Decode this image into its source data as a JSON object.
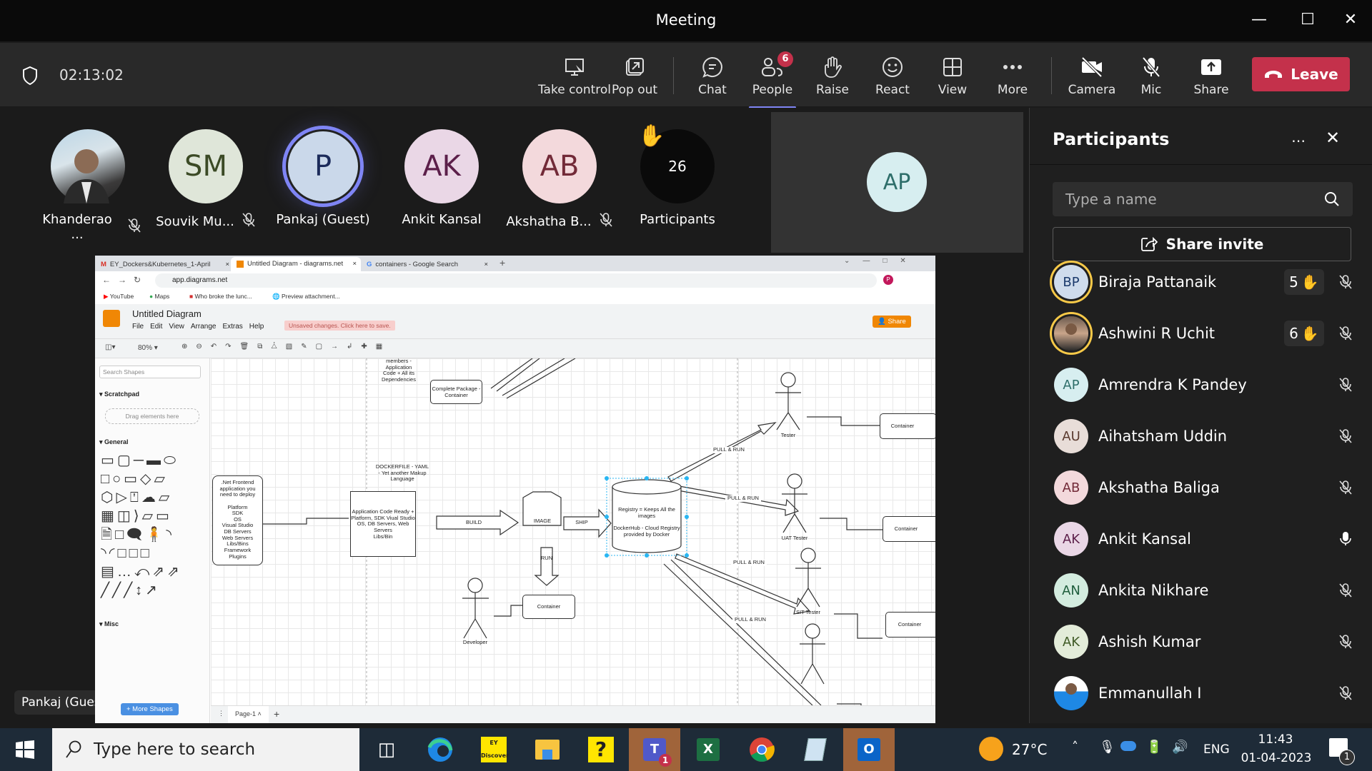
{
  "window": {
    "title": "Meeting"
  },
  "toolbar": {
    "timer": "02:13:02",
    "buttons": [
      {
        "label": "Take control",
        "icon": "take-control-icon"
      },
      {
        "label": "Pop out",
        "icon": "pop-out-icon"
      },
      {
        "label": "Chat",
        "icon": "chat-icon"
      },
      {
        "label": "People",
        "icon": "people-icon",
        "badge": "6"
      },
      {
        "label": "Raise",
        "icon": "raise-hand-icon"
      },
      {
        "label": "React",
        "icon": "react-icon"
      },
      {
        "label": "View",
        "icon": "view-icon"
      },
      {
        "label": "More",
        "icon": "more-icon"
      },
      {
        "label": "Camera",
        "icon": "camera-off-icon"
      },
      {
        "label": "Mic",
        "icon": "mic-off-icon"
      },
      {
        "label": "Share",
        "icon": "share-icon"
      }
    ],
    "leave_label": "Leave"
  },
  "stage": {
    "tiles": [
      {
        "name": "Khanderao ...",
        "initials": "",
        "photo": true,
        "muted": true
      },
      {
        "name": "Souvik Mu...",
        "initials": "SM",
        "bg": "#dfe6d9",
        "fg": "#3b4a25",
        "muted": true
      },
      {
        "name": "Pankaj (Guest)",
        "initials": "P",
        "bg": "#cad8ea",
        "fg": "#1b2a5a",
        "muted": false,
        "speaking": true
      },
      {
        "name": "Ankit Kansal",
        "initials": "AK",
        "bg": "#ead7e6",
        "fg": "#5c1f4a",
        "muted": false
      },
      {
        "name": "Akshatha B...",
        "initials": "AB",
        "bg": "#f3d9dc",
        "fg": "#722a38",
        "muted": true
      }
    ],
    "overflow": {
      "count": "26",
      "label": "Participants"
    },
    "spotlight": {
      "initials": "AP",
      "bg": "#d7eef0",
      "fg": "#2e6e6a"
    },
    "presenter_label": "Pankaj (Guest)"
  },
  "panel": {
    "title": "Participants",
    "search_placeholder": "Type a name",
    "share_invite": "Share invite",
    "participants": [
      {
        "name": "Biraja Pattanaik",
        "initials": "BP",
        "bg": "#cfdcec",
        "fg": "#1b3a6b",
        "hand": "5",
        "mic": "off",
        "ring": true
      },
      {
        "name": "Ashwini R Uchit",
        "initials": "",
        "photo": true,
        "hand": "6",
        "mic": "off",
        "ring": true
      },
      {
        "name": "Amrendra K Pandey",
        "initials": "AP",
        "bg": "#d7eef0",
        "fg": "#2e6e6a",
        "mic": "off"
      },
      {
        "name": "Aihatsham Uddin",
        "initials": "AU",
        "bg": "#e8ddd8",
        "fg": "#5a3a2e",
        "mic": "off"
      },
      {
        "name": "Akshatha Baliga",
        "initials": "AB",
        "bg": "#f3d9dc",
        "fg": "#722a38",
        "mic": "off"
      },
      {
        "name": "Ankit Kansal",
        "initials": "AK",
        "bg": "#ead7e6",
        "fg": "#5c1f4a",
        "mic": "on"
      },
      {
        "name": "Ankita Nikhare",
        "initials": "AN",
        "bg": "#d3ecdf",
        "fg": "#1f5e3d",
        "mic": "off"
      },
      {
        "name": "Ashish Kumar",
        "initials": "AK",
        "bg": "#e3ecd9",
        "fg": "#3f5a25",
        "mic": "off"
      },
      {
        "name": "Emmanullah I",
        "initials": "",
        "photo": true,
        "mic": "off"
      }
    ]
  },
  "browser": {
    "tabs": [
      {
        "label": "EY_Dockers&Kubernetes_1-April",
        "icon": "gmail-icon"
      },
      {
        "label": "Untitled Diagram - diagrams.net",
        "icon": "drawio-icon",
        "active": true
      },
      {
        "label": "containers - Google Search",
        "icon": "google-icon"
      }
    ],
    "url": "app.diagrams.net",
    "bookmarks": [
      "YouTube",
      "Maps",
      "Who broke the lunc...",
      "Preview attachment..."
    ]
  },
  "drawio": {
    "title": "Untitled Diagram",
    "menu": [
      "File",
      "Edit",
      "View",
      "Arrange",
      "Extras",
      "Help"
    ],
    "unsaved": "Unsaved changes. Click here to save.",
    "share": "Share",
    "zoom": "80%",
    "search_placeholder": "Search Shapes",
    "scratchpad": "Scratchpad",
    "drag_here": "Drag elements here",
    "general": "General",
    "misc": "Misc",
    "more_shapes": "+ More Shapes",
    "page_tab": "Page-1",
    "diagram": {
      "top_text": "members -\nApplication\nCode + All its\nDependencies",
      "complete_pkg": "Complete Package -\nContainer",
      "frontend": ".Net Frontend\napplication you\nneed to deploy\n\nPlatform\nSDK\nOS\nVisual Studio\nDB Servers\nWeb Servers\nLibs/Bins\nFramework\nPlugins",
      "dockerfile": "DOCKERFILE - YAML\n- Yet another Makup\nLanguage",
      "appcode": "Application Code Ready +\nPlatform, SDK Viual Studio\nOS, DB Servers, Web\nServers\nLibs/Bin",
      "build": "BUILD",
      "image": "IMAGE",
      "ship": "SHIP",
      "run": "RUN",
      "registry": "Registry = Keeps All the\nimages\n\nDockerHub - Cloud Registry\nprovided by Docker",
      "pull_run": "PULL & RUN",
      "container": "Container",
      "developer": "Developer",
      "tester": "Tester",
      "uat": "UAT Tester",
      "sit": "SIT Tester"
    }
  },
  "taskbar": {
    "search_placeholder": "Type here to search",
    "weather": "27°C",
    "lang": "ENG",
    "time": "11:43",
    "date": "01-04-2023",
    "notif_count": "1",
    "teams_badge": "1"
  }
}
